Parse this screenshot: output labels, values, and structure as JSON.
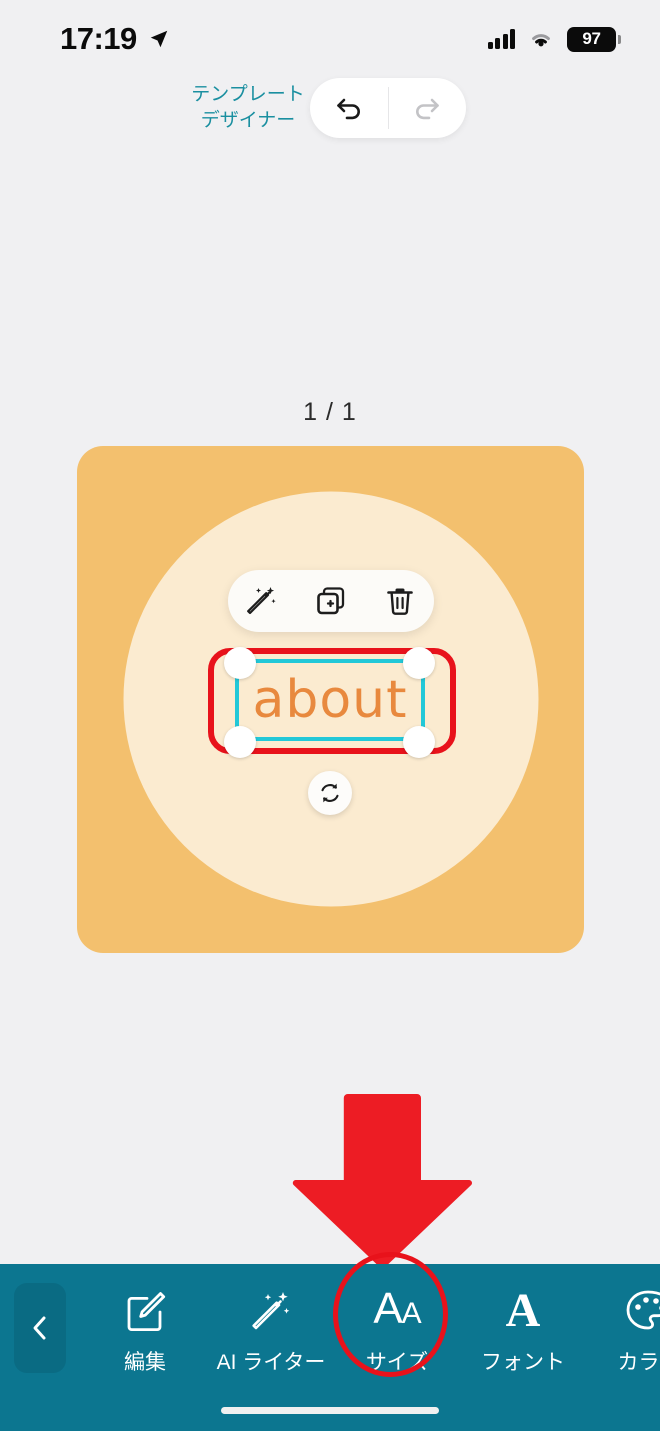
{
  "status_bar": {
    "time": "17:19",
    "location_icon": "location-arrow-icon",
    "cellular_icon": "cellular-bars-icon",
    "wifi_icon": "wifi-icon",
    "battery_level": "97"
  },
  "header": {
    "app_title_line1": "テンプレート",
    "app_title_line2": "デザイナー",
    "app_title_color": "#1a8fa0",
    "undo_label": "undo-icon",
    "redo_label": "redo-icon",
    "undo_enabled": "true",
    "redo_enabled": "false"
  },
  "canvas": {
    "page_indicator": "1 / 1",
    "background_color": "#f3c06e",
    "circle_color": "#fbebd0"
  },
  "element_toolbar": {
    "magic_label": "magic-wand-icon",
    "duplicate_label": "duplicate-icon",
    "delete_label": "trash-icon"
  },
  "selection": {
    "text": "about",
    "text_color": "#e8893e",
    "frame_color": "#22c8d8",
    "annotation_color": "#e8121b",
    "rotate_label": "rotate-icon"
  },
  "annotation": {
    "arrow_color": "#ed1c24",
    "highlight_color": "#e8121b"
  },
  "bottom_bar": {
    "background_color": "#0c7690",
    "back_label": "chevron-left-icon",
    "tools": [
      {
        "label": "編集",
        "icon": "edit-pencil-icon"
      },
      {
        "label": "AI ライター",
        "icon": "magic-wand-icon"
      },
      {
        "label": "サイズ",
        "icon": "text-size-icon"
      },
      {
        "label": "フォント",
        "icon": "font-icon"
      },
      {
        "label": "カラー",
        "icon": "palette-icon"
      }
    ]
  }
}
